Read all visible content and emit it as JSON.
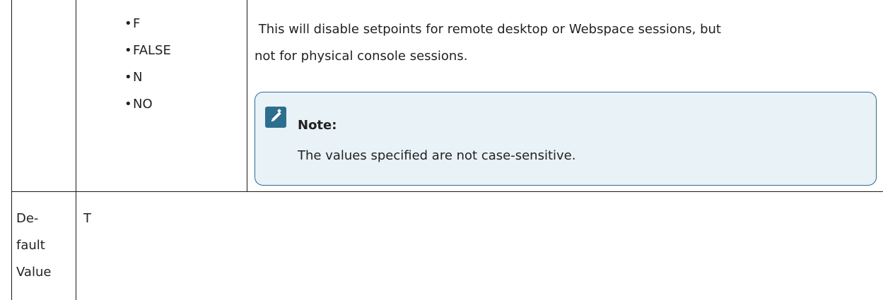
{
  "options_list": [
    "F",
    "FALSE",
    "N",
    "NO"
  ],
  "description_text_line1": " This will disable setpoints for remote desktop or Webspace sessions, but",
  "description_text_line2": "not for physical console sessions.",
  "note": {
    "icon": "pencil-icon",
    "title": "Note:",
    "body": "The values specified are not case-sensitive."
  },
  "default_row": {
    "label_lines": [
      "De-",
      "fault",
      "Value"
    ],
    "value": "T"
  },
  "colors": {
    "note_border": "#2a6f92",
    "note_background": "#e9f2f7",
    "note_icon": "#2d6e8f",
    "rule": "#1a1a1a"
  }
}
